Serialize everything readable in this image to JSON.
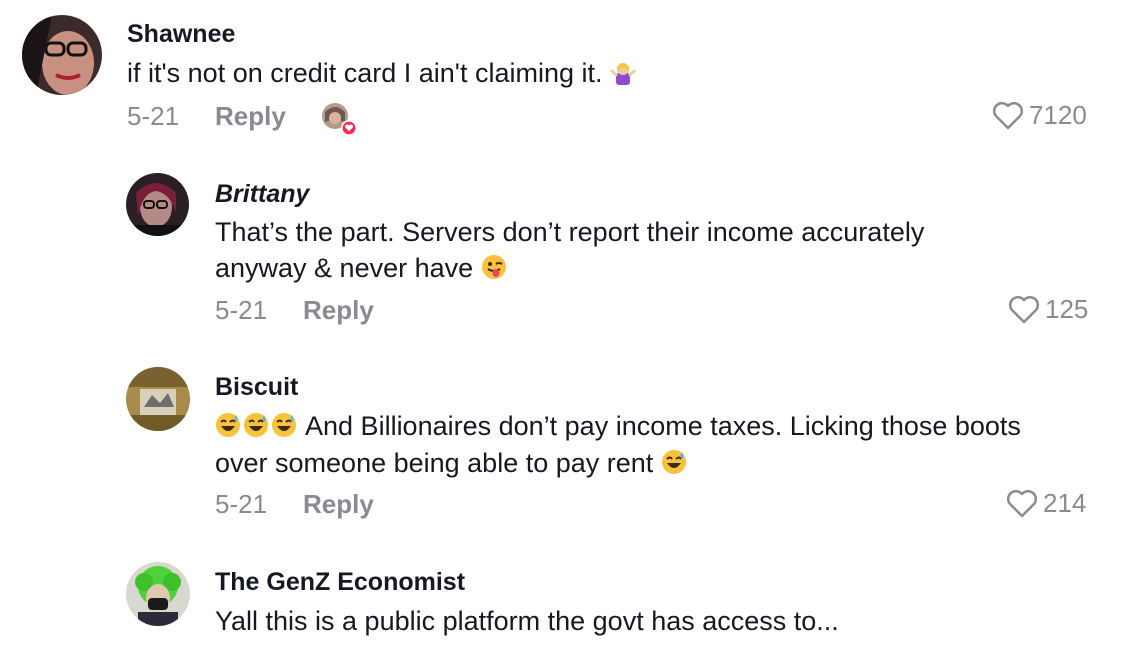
{
  "comments": [
    {
      "author": "Shawnee",
      "line1": "if it's not on credit card I ain't claiming it.",
      "date": "5-21",
      "reply_label": "Reply",
      "likes": "7120"
    },
    {
      "author": "Brittany",
      "line1": "That’s the part. Servers don’t report their income accurately",
      "line2": "anyway & never have",
      "date": "5-21",
      "reply_label": "Reply",
      "likes": "125"
    },
    {
      "author": "Biscuit",
      "line1": "And Billionaires don’t pay income taxes. Licking those boots",
      "line2": "over someone being able to pay rent",
      "date": "5-21",
      "reply_label": "Reply",
      "likes": "214"
    },
    {
      "author": "The GenZ Economist",
      "line1": "Yall this is a public platform the govt has access to..."
    }
  ],
  "colors": {
    "text": "#161823",
    "muted": "#8a8b91",
    "like_badge": "#fe2c55"
  },
  "icons": [
    "heart-outline-icon",
    "creator-liked-badge-icon",
    "shrug-emoji-icon",
    "winking-tongue-emoji-icon",
    "sweat-smile-emoji-icon"
  ]
}
